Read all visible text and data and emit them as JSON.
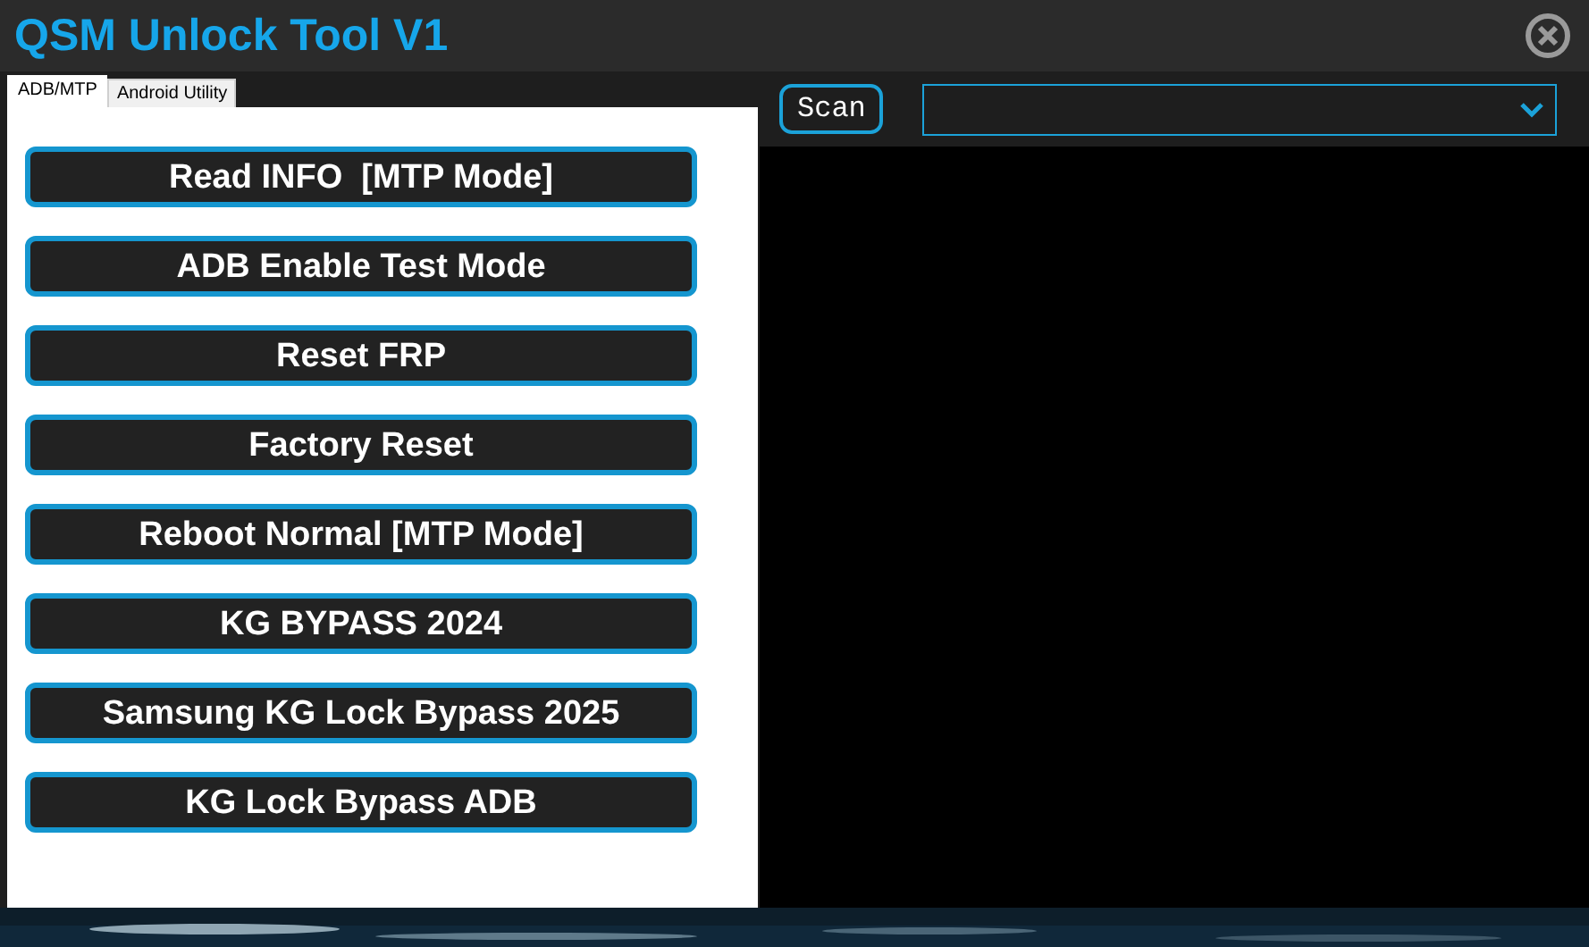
{
  "window": {
    "title": "QSM Unlock Tool V1"
  },
  "tabs": [
    {
      "label": "ADB/MTP",
      "selected": true
    },
    {
      "label": "Android Utility",
      "selected": false
    }
  ],
  "buttons": [
    "Read INFO  [MTP Mode]",
    "ADB Enable Test Mode",
    "Reset FRP",
    "Factory Reset",
    "Reboot Normal [MTP Mode]",
    "KG BYPASS 2024",
    "Samsung KG Lock Bypass 2025",
    "KG Lock Bypass ADB"
  ],
  "scan_button": "Scan"
}
